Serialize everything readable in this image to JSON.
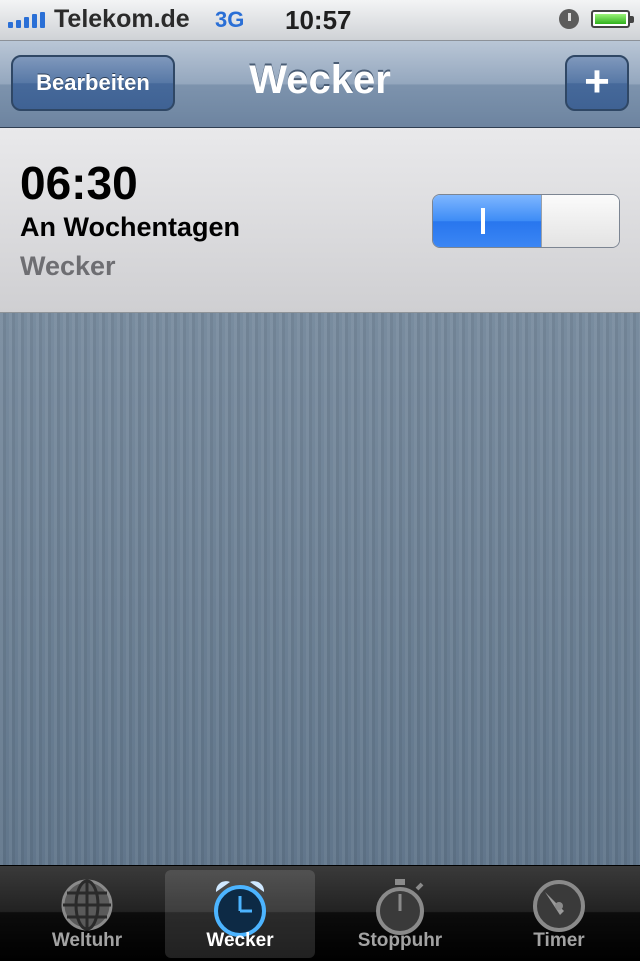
{
  "status_bar": {
    "carrier": "Telekom.de",
    "network": "3G",
    "time": "10:57",
    "icons": [
      "signal-icon",
      "alarm-clock-icon",
      "battery-icon"
    ]
  },
  "nav": {
    "title": "Wecker",
    "edit_label": "Bearbeiten",
    "add_label": "+"
  },
  "alarms": [
    {
      "time": "06:30",
      "repeat": "An Wochentagen",
      "label": "Wecker",
      "enabled": true,
      "toggle_on_text": "I"
    }
  ],
  "tabs": [
    {
      "label": "Weltuhr",
      "icon": "globe-icon",
      "active": false
    },
    {
      "label": "Wecker",
      "icon": "alarm-clock-icon",
      "active": true
    },
    {
      "label": "Stoppuhr",
      "icon": "stopwatch-icon",
      "active": false
    },
    {
      "label": "Timer",
      "icon": "timer-icon",
      "active": false
    }
  ],
  "colors": {
    "accent_blue": "#2a6fd6",
    "toggle_on": "#3d8cf6",
    "active_tab_icon": "#4cb4ff"
  }
}
